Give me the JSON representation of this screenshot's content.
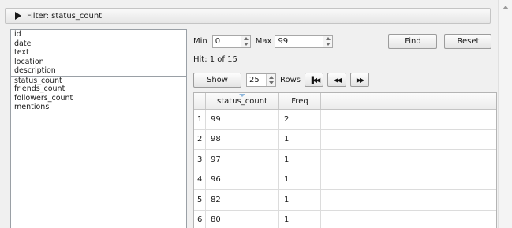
{
  "filter": {
    "label": "Filter: status_count"
  },
  "fields": [
    "id",
    "date",
    "text",
    "location",
    "description",
    "status_count",
    "friends_count",
    "followers_count",
    "mentions"
  ],
  "selected_field": "status_count",
  "range": {
    "min_label": "Min",
    "min_value": "0",
    "max_label": "Max",
    "max_value": "99"
  },
  "buttons": {
    "find": "Find",
    "reset": "Reset",
    "show": "Show"
  },
  "hit": "Hit: 1  of 15",
  "rows_control": {
    "value": "25",
    "label": "Rows"
  },
  "nav": {
    "first": "▐◀◀",
    "prev": "◀◀",
    "next": "▶▶"
  },
  "table": {
    "columns": [
      "",
      "status_count",
      "Freq",
      ""
    ],
    "rows": [
      {
        "index": "1",
        "status_count": "99",
        "freq": "2"
      },
      {
        "index": "2",
        "status_count": "98",
        "freq": "1"
      },
      {
        "index": "3",
        "status_count": "97",
        "freq": "1"
      },
      {
        "index": "4",
        "status_count": "96",
        "freq": "1"
      },
      {
        "index": "5",
        "status_count": "82",
        "freq": "1"
      },
      {
        "index": "6",
        "status_count": "80",
        "freq": "1"
      }
    ]
  },
  "colors": {
    "panel": "#f0f0f0",
    "border": "#9aa0a6",
    "sort_indicator": "#8fb7dc"
  }
}
